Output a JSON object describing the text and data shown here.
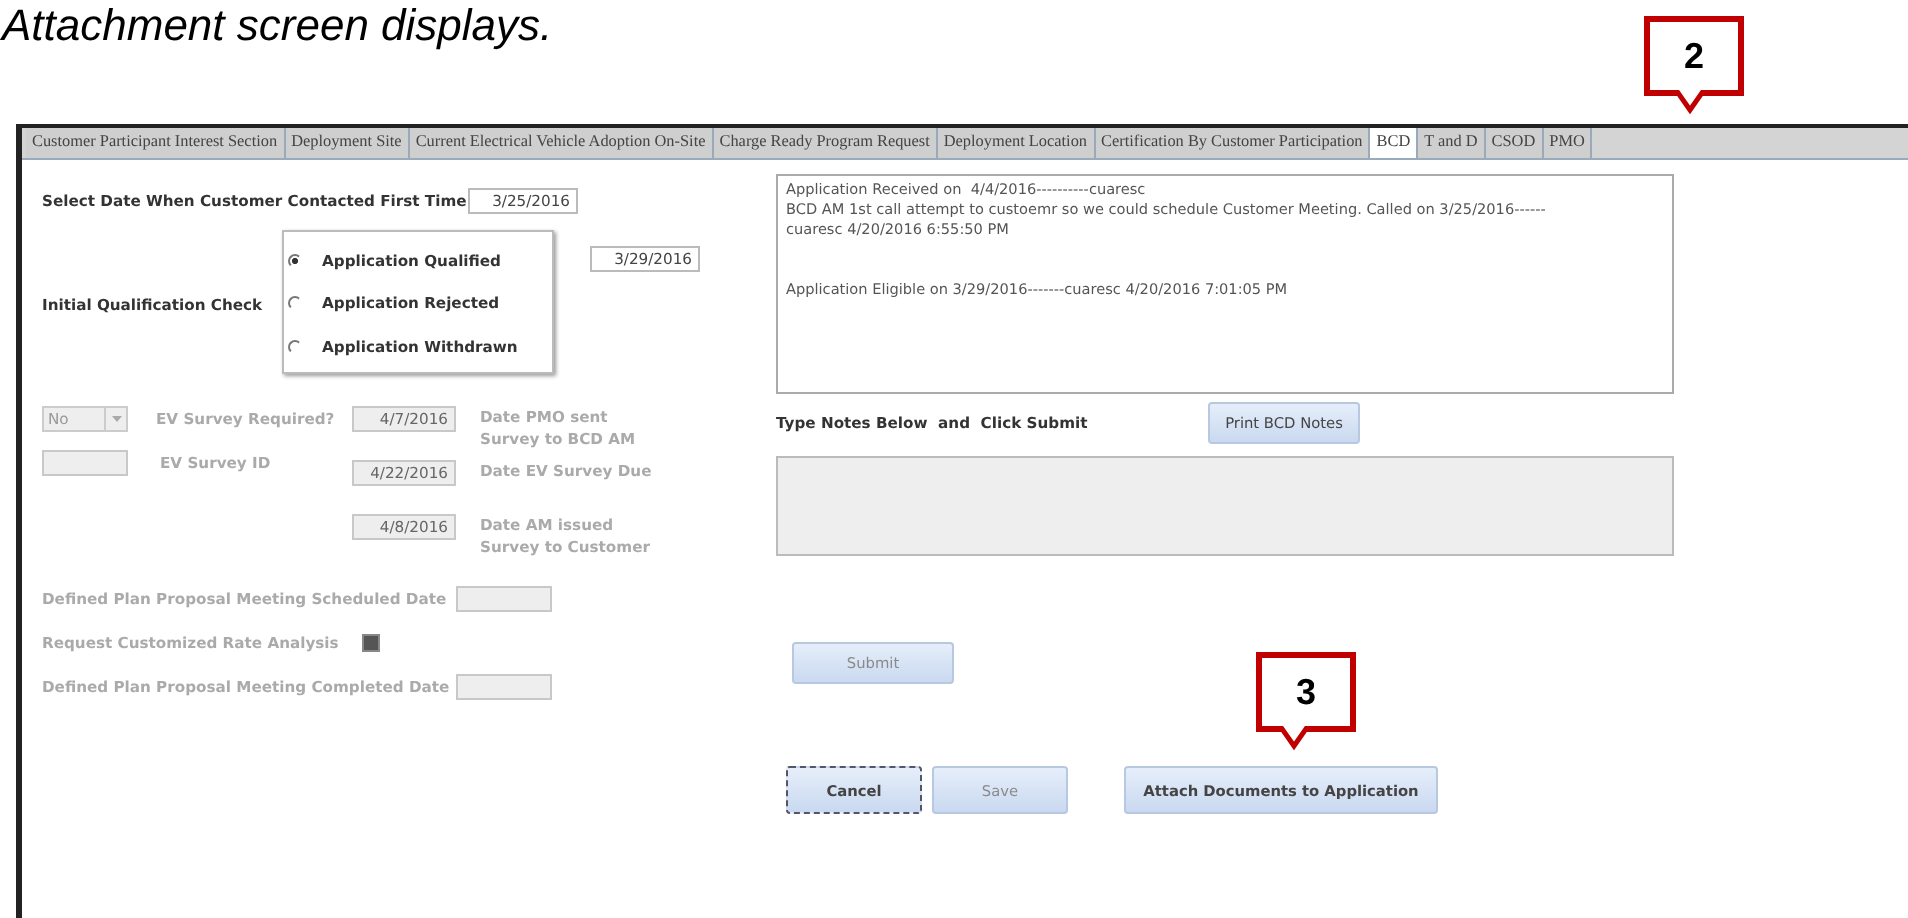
{
  "caption": "Attachment screen displays.",
  "callouts": [
    {
      "number": "2"
    },
    {
      "number": "3"
    }
  ],
  "tabs": [
    {
      "label": "Customer Participant Interest Section",
      "selected": false
    },
    {
      "label": "Deployment Site",
      "selected": false
    },
    {
      "label": "Current Electrical Vehicle  Adoption On-Site",
      "selected": false
    },
    {
      "label": "Charge Ready Program Request",
      "selected": false
    },
    {
      "label": "Deployment Location",
      "selected": false
    },
    {
      "label": "Certification By Customer Participation",
      "selected": false
    },
    {
      "label": "BCD",
      "selected": true
    },
    {
      "label": "T and D",
      "selected": false
    },
    {
      "label": "CSOD",
      "selected": false
    },
    {
      "label": "PMO",
      "selected": false
    }
  ],
  "first_contact": {
    "label": "Select Date When Customer Contacted First Time",
    "value": "3/25/2016"
  },
  "qualification": {
    "label": "Initial Qualification Check",
    "date": "3/29/2016",
    "options": [
      {
        "label": "Application Qualified",
        "selected": true
      },
      {
        "label": "Application Rejected",
        "selected": false
      },
      {
        "label": "Application Withdrawn",
        "selected": false
      }
    ]
  },
  "ev_survey": {
    "required": {
      "value": "No",
      "label": "EV Survey Required?"
    },
    "id_label": "EV Survey ID",
    "dates": [
      {
        "value": "4/7/2016",
        "label": "Date PMO sent\nSurvey to BCD AM"
      },
      {
        "value": "4/22/2016",
        "label": "Date EV Survey Due"
      },
      {
        "value": "4/8/2016",
        "label": "Date AM issued\nSurvey to Customer"
      }
    ]
  },
  "plan": [
    {
      "kind": "date",
      "label": "Defined Plan Proposal Meeting Scheduled Date"
    },
    {
      "kind": "checkbox",
      "label": "Request Customized Rate Analysis",
      "checked": true
    },
    {
      "kind": "date",
      "label": "Defined Plan Proposal Meeting Completed Date"
    }
  ],
  "notes_log": [
    [
      "Application Received on  4/4/2016----------cuaresc",
      "BCD AM 1st call attempt to custoemr so we could schedule Customer Meeting. Called on 3/25/2016------\ncuaresc 4/20/2016 6:55:50 PM"
    ],
    [
      "Application Eligible on 3/29/2016-------cuaresc 4/20/2016 7:01:05 PM"
    ]
  ],
  "notes_prompt": "Type Notes Below  and  Click Submit",
  "print_button": "Print BCD Notes",
  "submit_button": {
    "label": "Submit",
    "disabled": true
  },
  "buttons": [
    {
      "label": "Cancel",
      "disabled": false,
      "focused": true
    },
    {
      "label": "Save",
      "disabled": true,
      "focused": false
    },
    {
      "label": "Attach Documents to Application",
      "disabled": false,
      "focused": false
    }
  ]
}
